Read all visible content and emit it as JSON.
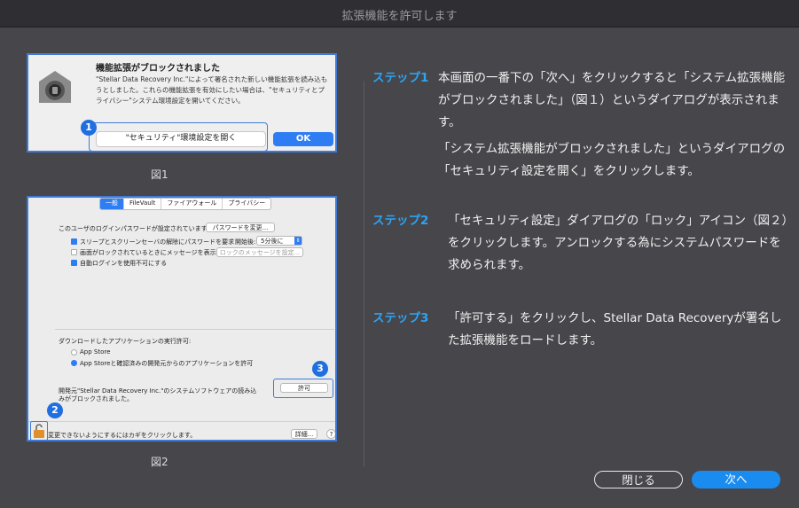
{
  "window": {
    "title": "拡張機能を許可します"
  },
  "fig1": {
    "caption": "図1",
    "heading": "機能拡張がブロックされました",
    "message": "\"Stellar Data Recovery Inc.\"によって署名された新しい機能拡張を読み込もうとしました。これらの機能拡張を有効にしたい場合は、\"セキュリティとプライバシー\"システム環境設定を開いてください。",
    "open_button": "\"セキュリティ\"環境設定を開く",
    "ok_button": "OK",
    "badge": "1"
  },
  "fig2": {
    "caption": "図2",
    "tabs": [
      "一般",
      "FileVault",
      "ファイアウォール",
      "プライバシー"
    ],
    "password_text": "このユーザのログインパスワードが設定されています",
    "change_password": "パスワードを変更...",
    "require_password": "スリープとスクリーンセーバの解除にパスワードを要求",
    "start_label": "開始後:",
    "start_value": "5分後に",
    "show_message": "画面がロックされているときにメッセージを表示",
    "lock_message_btn": "ロックのメッセージを設定...",
    "disable_autologin": "自動ログインを使用不可にする",
    "download_label": "ダウンロードしたアプリケーションの実行許可:",
    "option_appstore": "App Store",
    "option_identified": "App Storeと確認済みの開発元からのアプリケーションを許可",
    "blocked_text": "開発元\"Stellar Data Recovery Inc.\"のシステムソフトウェアの読み込みがブロックされました。",
    "allow_button": "許可",
    "lock_text": "変更できないようにするにはカギをクリックします。",
    "advanced_button": "詳細...",
    "help": "?",
    "badge_lock": "2",
    "badge_allow": "3"
  },
  "steps": [
    {
      "label": "ステップ1",
      "text": "本画面の一番下の「次へ」をクリックすると「システム拡張機能がブロックされました」（図１）というダイアログが表示されます。",
      "text2": "「システム拡張機能がブロックされました」というダイアログの「セキュリティ設定を開く」をクリックします。"
    },
    {
      "label": "ステップ2",
      "text": "「セキュリティ設定」ダイアログの「ロック」アイコン（図２）をクリックします。アンロックする為にシステムパスワードを求められます。"
    },
    {
      "label": "ステップ3",
      "text": "「許可する」をクリックし、Stellar Data Recoveryが署名した拡張機能をロードします。"
    }
  ],
  "buttons": {
    "close": "閉じる",
    "next": "次へ"
  },
  "colors": {
    "accent": "#2ea3f0",
    "next_button": "#1a8cf0",
    "selection_border": "#3f7bd6"
  }
}
